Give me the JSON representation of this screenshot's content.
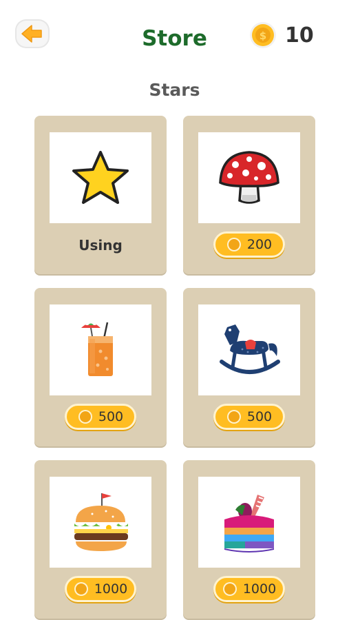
{
  "header": {
    "title": "Store",
    "coins": "10"
  },
  "section": {
    "title": "Stars"
  },
  "items": [
    {
      "name": "star",
      "status": "Using"
    },
    {
      "name": "mushroom",
      "price": "200"
    },
    {
      "name": "juice",
      "price": "500"
    },
    {
      "name": "rocking-horse",
      "price": "500"
    },
    {
      "name": "burger",
      "price": "1000"
    },
    {
      "name": "cake",
      "price": "1000"
    }
  ],
  "colors": {
    "title_green": "#1d6b2b",
    "card_beige": "#dccfb4",
    "price_orange": "#ffbd22",
    "back_orange": "#ffb024"
  }
}
